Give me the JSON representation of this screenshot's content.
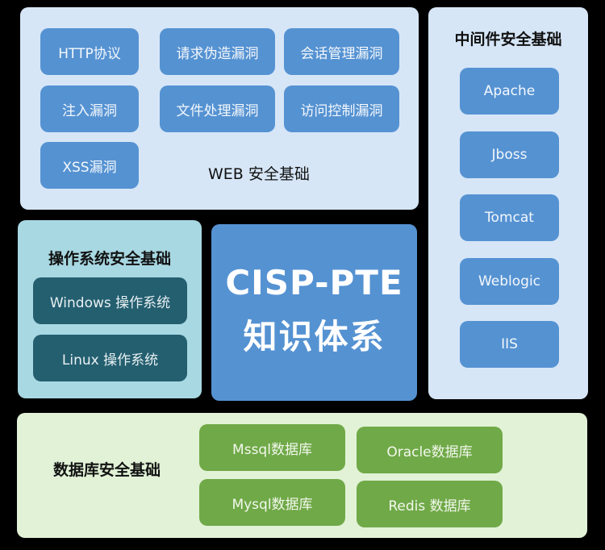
{
  "title": {
    "line1": "CISP-PTE",
    "line2": "知识体系"
  },
  "web": {
    "heading": "WEB 安全基础",
    "items": [
      "HTTP协议",
      "请求伪造漏洞",
      "会话管理漏洞",
      "注入漏洞",
      "文件处理漏洞",
      "访问控制漏洞",
      "XSS漏洞"
    ]
  },
  "middleware": {
    "heading": "中间件安全基础",
    "items": [
      "Apache",
      "Jboss",
      "Tomcat",
      "Weblogic",
      "IIS"
    ]
  },
  "os": {
    "heading": "操作系统安全基础",
    "items": [
      "Windows 操作系统",
      "Linux 操作系统"
    ]
  },
  "database": {
    "heading": "数据库安全基础",
    "items": [
      "Mssql数据库",
      "Oracle数据库",
      "Mysql数据库",
      "Redis 数据库"
    ]
  },
  "colors": {
    "web_panel": "#d6e6f7",
    "blue_button": "#5592d2",
    "os_panel": "#a8d8e2",
    "teal_button": "#245f70",
    "db_panel": "#e1f2d6",
    "green_button": "#70a948",
    "background": "#000000"
  }
}
